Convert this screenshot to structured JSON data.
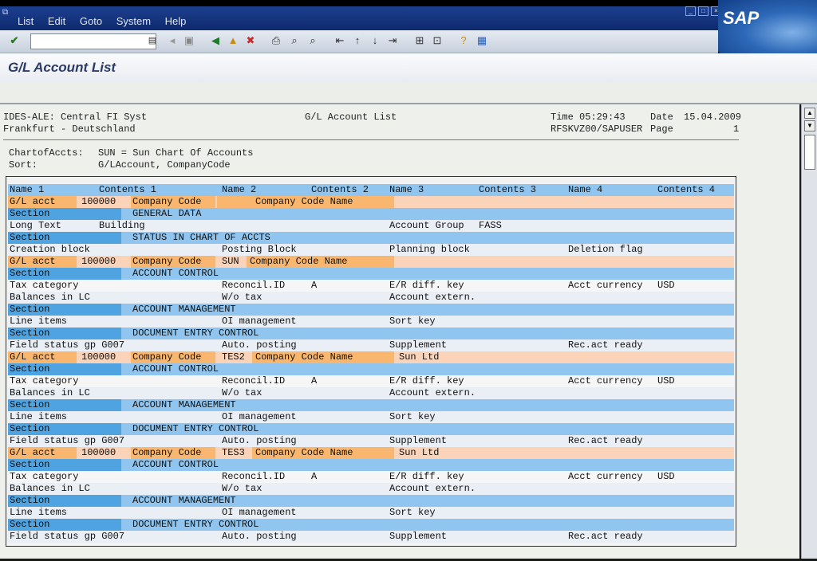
{
  "menu": [
    "List",
    "Edit",
    "Goto",
    "System",
    "Help"
  ],
  "brand": "SAP",
  "title": "G/L Account List",
  "report_header": {
    "left1": "IDES-ALE: Central FI Syst",
    "left2": "Frankfurt - Deutschland",
    "center": "G/L Account List",
    "time_label": "Time 05:29:43",
    "prog": "RFSKVZ00/SAPUSER",
    "date_label": "Date",
    "date_value": "15.04.2009",
    "page_label": "Page",
    "page_value": "1"
  },
  "selection": {
    "coa_label": "ChartofAccts:",
    "coa_value": "SUN = Sun Chart Of Accounts",
    "sort_label": "Sort:",
    "sort_value": "G/LAccount, CompanyCode"
  },
  "columns": [
    "Name 1",
    "Contents 1",
    "Name 2",
    "Contents 2",
    "Name 3",
    "Contents 3",
    "Name 4",
    "Contents 4"
  ],
  "rows": [
    {
      "style": "orange",
      "cells": [
        "G/L acct",
        "100000",
        "Company Code",
        "",
        "Company Code Name",
        "",
        "",
        ""
      ]
    },
    {
      "style": "section",
      "cells": [
        "Section",
        "GENERAL DATA"
      ]
    },
    {
      "style": "white",
      "cells": [
        "Long Text",
        "Building",
        "",
        "",
        "Account Group",
        "FASS",
        "",
        ""
      ]
    },
    {
      "style": "section",
      "cells": [
        "Section",
        "STATUS IN CHART OF ACCTS"
      ]
    },
    {
      "style": "white",
      "cells": [
        "Creation block",
        "",
        "Posting Block",
        "",
        "Planning block",
        "",
        "Deletion flag",
        ""
      ]
    },
    {
      "style": "orange",
      "cells": [
        "G/L acct",
        "100000",
        "Company Code",
        "SUN",
        "Company Code Name",
        "",
        "",
        ""
      ]
    },
    {
      "style": "section",
      "cells": [
        "Section",
        "ACCOUNT CONTROL"
      ]
    },
    {
      "style": "white",
      "cells": [
        "Tax category",
        "",
        "Reconcil.ID",
        "A",
        "E/R diff. key",
        "",
        "Acct currency",
        "USD"
      ]
    },
    {
      "style": "white",
      "cells": [
        "Balances in LC",
        "",
        "W/o tax",
        "",
        "Account extern.",
        "",
        "",
        ""
      ]
    },
    {
      "style": "section",
      "cells": [
        "Section",
        "ACCOUNT MANAGEMENT"
      ]
    },
    {
      "style": "white",
      "cells": [
        "Line items",
        "",
        "OI management",
        "",
        "Sort key",
        "",
        "",
        ""
      ]
    },
    {
      "style": "section",
      "cells": [
        "Section",
        "DOCUMENT ENTRY CONTROL"
      ]
    },
    {
      "style": "white",
      "cells": [
        "Field status gp G007",
        "",
        "Auto. posting",
        "",
        "Supplement",
        "",
        "Rec.act ready",
        ""
      ]
    },
    {
      "style": "orange",
      "cells": [
        "G/L acct",
        "100000",
        "Company Code",
        "TES2",
        "Company Code Name",
        "Sun Ltd",
        "",
        ""
      ]
    },
    {
      "style": "section",
      "cells": [
        "Section",
        "ACCOUNT CONTROL"
      ]
    },
    {
      "style": "white",
      "cells": [
        "Tax category",
        "",
        "Reconcil.ID",
        "A",
        "E/R diff. key",
        "",
        "Acct currency",
        "USD"
      ]
    },
    {
      "style": "white",
      "cells": [
        "Balances in LC",
        "",
        "W/o tax",
        "",
        "Account extern.",
        "",
        "",
        ""
      ]
    },
    {
      "style": "section",
      "cells": [
        "Section",
        "ACCOUNT MANAGEMENT"
      ]
    },
    {
      "style": "white",
      "cells": [
        "Line items",
        "",
        "OI management",
        "",
        "Sort key",
        "",
        "",
        ""
      ]
    },
    {
      "style": "section",
      "cells": [
        "Section",
        "DOCUMENT ENTRY CONTROL"
      ]
    },
    {
      "style": "white",
      "cells": [
        "Field status gp G007",
        "",
        "Auto. posting",
        "",
        "Supplement",
        "",
        "Rec.act ready",
        ""
      ]
    },
    {
      "style": "orange",
      "cells": [
        "G/L acct",
        "100000",
        "Company Code",
        "TES3",
        "Company Code Name",
        "Sun Ltd",
        "",
        ""
      ]
    },
    {
      "style": "section",
      "cells": [
        "Section",
        "ACCOUNT CONTROL"
      ]
    },
    {
      "style": "white",
      "cells": [
        "Tax category",
        "",
        "Reconcil.ID",
        "A",
        "E/R diff. key",
        "",
        "Acct currency",
        "USD"
      ]
    },
    {
      "style": "white",
      "cells": [
        "Balances in LC",
        "",
        "W/o tax",
        "",
        "Account extern.",
        "",
        "",
        ""
      ]
    },
    {
      "style": "section",
      "cells": [
        "Section",
        "ACCOUNT MANAGEMENT"
      ]
    },
    {
      "style": "white",
      "cells": [
        "Line items",
        "",
        "OI management",
        "",
        "Sort key",
        "",
        "",
        ""
      ]
    },
    {
      "style": "section",
      "cells": [
        "Section",
        "DOCUMENT ENTRY CONTROL"
      ]
    },
    {
      "style": "white",
      "cells": [
        "Field status gp G007",
        "",
        "Auto. posting",
        "",
        "Supplement",
        "",
        "Rec.act ready",
        ""
      ]
    }
  ],
  "icons": [
    "enter-icon",
    "save-icon",
    "back-icon",
    "exit-icon",
    "cancel-icon",
    "print-icon",
    "find-icon",
    "find-next-icon",
    "first-page-icon",
    "prev-page-icon",
    "next-page-icon",
    "last-page-icon",
    "create-session-icon",
    "shortcut-icon",
    "help-icon",
    "layout-icon"
  ]
}
